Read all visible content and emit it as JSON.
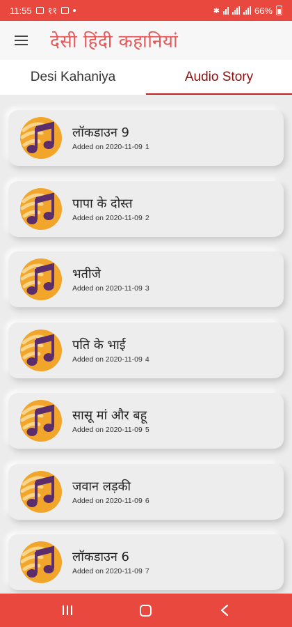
{
  "status_bar": {
    "time": "11:55",
    "extra": "११",
    "battery": "66%"
  },
  "app": {
    "title": "देसी हिंदी कहानियां",
    "menu_icon": "hamburger-menu-icon"
  },
  "tabs": [
    {
      "label": "Desi Kahaniya",
      "active": false
    },
    {
      "label": "Audio Story",
      "active": true
    }
  ],
  "list": {
    "added_prefix": "Added on",
    "items": [
      {
        "title": "लॉकडाउन  9",
        "date": "2020-11-09",
        "number": "1"
      },
      {
        "title": "पापा के दोस्त",
        "date": "2020-11-09",
        "number": "2"
      },
      {
        "title": "भतीजे",
        "date": "2020-11-09",
        "number": "3"
      },
      {
        "title": "पति के भाई",
        "date": "2020-11-09",
        "number": "4"
      },
      {
        "title": "सासू मां और बहू",
        "date": "2020-11-09",
        "number": "5"
      },
      {
        "title": "जवान लड़की",
        "date": "2020-11-09",
        "number": "6"
      },
      {
        "title": "लॉकडाउन  6",
        "date": "2020-11-09",
        "number": "7"
      }
    ]
  },
  "colors": {
    "accent": "#e8483e",
    "tab_active": "#8a1010",
    "icon_orange": "#f2a52b",
    "icon_purple": "#5b2d6b"
  }
}
